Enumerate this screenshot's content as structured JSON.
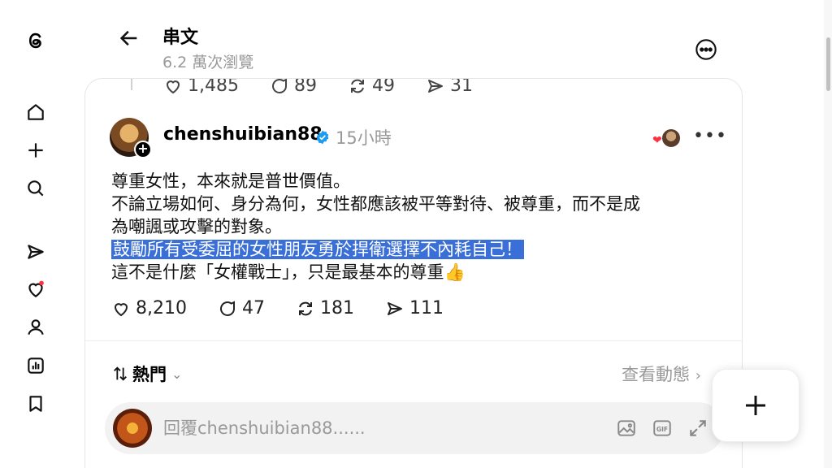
{
  "header": {
    "title": "串文",
    "views": "6.2 萬次瀏覽"
  },
  "previous_post_stats": {
    "likes": "1,485",
    "comments": "89",
    "reposts": "49",
    "shares": "31"
  },
  "post": {
    "username": "chenshuibian88",
    "time": "15小時",
    "lines": [
      "尊重女性，本來就是普世價值。",
      "不論立場如何、身分為何，女性都應該被平等對待、被尊重，而不是成",
      "為嘲諷或攻擊的對象。",
      "鼓勵所有受委屈的女性朋友勇於捍衛選擇不內耗自己！",
      "這不是什麼「女權戰士」，只是最基本的尊重👍"
    ],
    "stats": {
      "likes": "8,210",
      "comments": "47",
      "reposts": "181",
      "shares": "111"
    }
  },
  "sort": {
    "label": "熱門"
  },
  "activity_link": "查看動態",
  "reply": {
    "placeholder": "回覆chenshuibian88......"
  },
  "icons": {
    "sidebar": [
      "threads-logo-icon",
      "home-icon",
      "create-icon",
      "search-icon",
      "send-icon",
      "activity-heart-icon",
      "profile-icon",
      "insights-icon",
      "saved-icon"
    ],
    "accent_blue": "#3a6fd8",
    "notification_dot": "#ff3040"
  }
}
